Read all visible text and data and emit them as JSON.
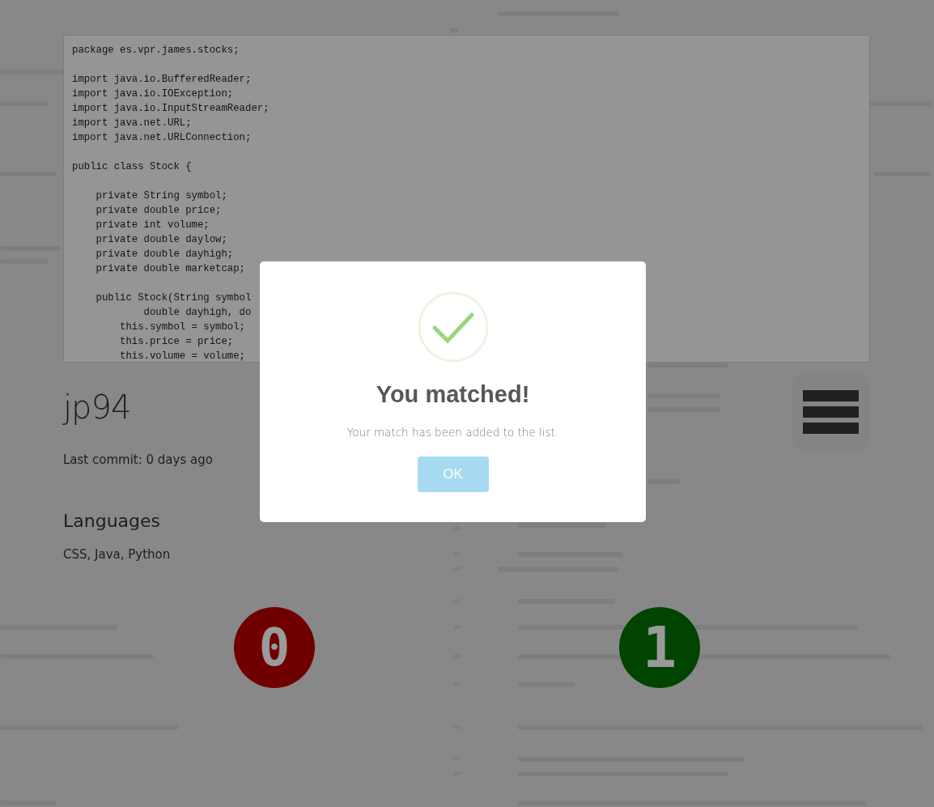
{
  "code_panel": {
    "blocks": [
      [
        "package es.vpr.james.stocks;"
      ],
      [
        "import java.io.BufferedReader;",
        "import java.io.IOException;",
        "import java.io.InputStreamReader;",
        "import java.net.URL;",
        "import java.net.URLConnection;"
      ],
      [
        "public class Stock {"
      ],
      [
        "    private String symbol;",
        "    private double price;",
        "    private int volume;",
        "    private double daylow;",
        "    private double dayhigh;",
        "    private double marketcap;"
      ],
      [
        "    public Stock(String symbol",
        "            double dayhigh, do",
        "        this.symbol = symbol;",
        "        this.price = price;",
        "        this.volume = volume;"
      ]
    ]
  },
  "profile": {
    "username": "jp94",
    "last_commit": "Last commit: 0 days ago",
    "languages_heading": "Languages",
    "languages": "CSS, Java, Python"
  },
  "votes": [
    {
      "label": "0",
      "kind": "reject",
      "color": "#700000"
    },
    {
      "label": "1",
      "kind": "accept",
      "color": "#004400"
    }
  ],
  "dialog": {
    "title": "You matched!",
    "message": "Your match has been added to the list.",
    "button": "OK"
  }
}
